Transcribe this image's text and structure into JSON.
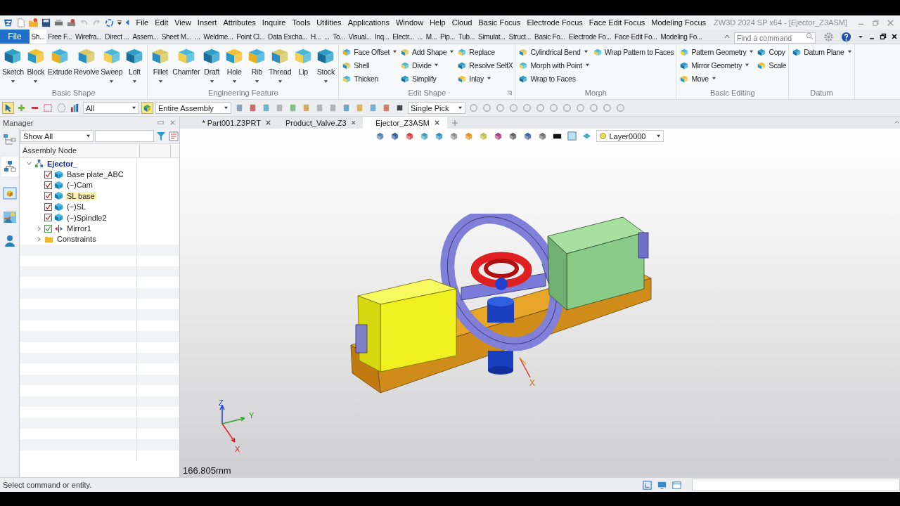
{
  "window": {
    "title": "ZW3D 2024 SP x64 - [Ejector_Z3ASM]"
  },
  "menu": [
    "File",
    "Edit",
    "View",
    "Insert",
    "Attributes",
    "Inquire",
    "Tools",
    "Utilities",
    "Applications",
    "Window",
    "Help",
    "Cloud",
    "Basic Focus",
    "Electrode Focus",
    "Face Edit Focus",
    "Modeling Focus"
  ],
  "file_button": "File",
  "ribbon_tabs": [
    {
      "label": "Sh...",
      "selected": true
    },
    {
      "label": "Free F...",
      "selected": false
    },
    {
      "label": "Wirefra...",
      "selected": false
    },
    {
      "label": "Direct ...",
      "selected": false
    },
    {
      "label": "Assem...",
      "selected": false
    },
    {
      "label": "Sheet M...",
      "selected": false
    },
    {
      "label": "...",
      "selected": false
    },
    {
      "label": "Weldme...",
      "selected": false
    },
    {
      "label": "Point Cl...",
      "selected": false
    },
    {
      "label": "Data Excha...",
      "selected": false
    },
    {
      "label": "H...",
      "selected": false
    },
    {
      "label": "...",
      "selected": false
    },
    {
      "label": "To...",
      "selected": false
    },
    {
      "label": "Visual...",
      "selected": false
    },
    {
      "label": "Inq...",
      "selected": false
    },
    {
      "label": "Electr...",
      "selected": false
    },
    {
      "label": "...",
      "selected": false
    },
    {
      "label": "M...",
      "selected": false
    },
    {
      "label": "Pip...",
      "selected": false
    },
    {
      "label": "Tub...",
      "selected": false
    },
    {
      "label": "Simulat...",
      "selected": false
    },
    {
      "label": "Struct...",
      "selected": false
    },
    {
      "label": "Basic Fo...",
      "selected": false
    },
    {
      "label": "Electrode Fo...",
      "selected": false
    },
    {
      "label": "Face Edit Fo...",
      "selected": false
    },
    {
      "label": "Modeling Fo...",
      "selected": false
    }
  ],
  "command_search": {
    "placeholder": "Find a command"
  },
  "ribbon_groups": [
    {
      "title": "Basic Shape",
      "kind": "large",
      "tools": [
        {
          "label": "Sketch",
          "dropdown": true
        },
        {
          "label": "Block",
          "dropdown": true
        },
        {
          "label": "Extrude",
          "dropdown": false
        },
        {
          "label": "Revolve",
          "dropdown": false
        },
        {
          "label": "Sweep",
          "dropdown": true
        },
        {
          "label": "Loft",
          "dropdown": true
        }
      ]
    },
    {
      "title": "Engineering Feature",
      "kind": "large",
      "tools": [
        {
          "label": "Fillet",
          "dropdown": true
        },
        {
          "label": "Chamfer",
          "dropdown": false
        },
        {
          "label": "Draft",
          "dropdown": true
        },
        {
          "label": "Hole",
          "dropdown": true
        },
        {
          "label": "Rib",
          "dropdown": true
        },
        {
          "label": "Thread",
          "dropdown": true
        },
        {
          "label": "Lip",
          "dropdown": false
        },
        {
          "label": "Stock",
          "dropdown": true
        }
      ]
    },
    {
      "title": "Edit Shape",
      "kind": "small",
      "columns": [
        [
          {
            "label": "Face Offset",
            "dropdown": true
          },
          {
            "label": "Shell",
            "dropdown": false
          },
          {
            "label": "Thicken",
            "dropdown": false
          }
        ],
        [
          {
            "label": "Add Shape",
            "dropdown": true
          },
          {
            "label": "Divide",
            "dropdown": true
          },
          {
            "label": "Simplify",
            "dropdown": false
          }
        ],
        [
          {
            "label": "Replace",
            "dropdown": false
          },
          {
            "label": "Resolve SelfX",
            "dropdown": false
          },
          {
            "label": "Inlay",
            "dropdown": true
          }
        ]
      ]
    },
    {
      "title": "Morph",
      "kind": "small",
      "columns": [
        [
          {
            "label": "Cylindrical Bend",
            "dropdown": true
          },
          {
            "label": "Morph with Point",
            "dropdown": true
          },
          {
            "label": "Wrap to Faces",
            "dropdown": false
          }
        ],
        [
          {
            "label": "Wrap Pattern to Faces",
            "dropdown": false
          }
        ]
      ]
    },
    {
      "title": "Basic Editing",
      "kind": "small",
      "columns": [
        [
          {
            "label": "Pattern Geometry",
            "dropdown": true
          },
          {
            "label": "Mirror Geometry",
            "dropdown": true
          },
          {
            "label": "Move",
            "dropdown": true
          }
        ],
        [
          {
            "label": "Copy",
            "dropdown": false
          },
          {
            "label": "Scale",
            "dropdown": false
          }
        ]
      ]
    },
    {
      "title": "Datum",
      "kind": "small",
      "columns": [
        [
          {
            "label": "Datum Plane",
            "dropdown": true
          }
        ]
      ]
    }
  ],
  "toolbar": {
    "filter": "All",
    "scope": "Entire Assembly",
    "pick_mode": "Single Pick"
  },
  "manager": {
    "title": "Manager",
    "show_filter": "Show All",
    "column": "Assembly Node",
    "tree": [
      {
        "label": "Ejector_",
        "kind": "assembly",
        "expanded": true,
        "selected": false,
        "children": [
          {
            "label": "Base plate_ABC",
            "kind": "part",
            "checked": true,
            "selected": false
          },
          {
            "label": "(−)Cam",
            "kind": "part",
            "checked": true,
            "selected": false
          },
          {
            "label": "SL base",
            "kind": "part",
            "checked": true,
            "selected": true
          },
          {
            "label": "(−)SL",
            "kind": "part",
            "checked": true,
            "selected": false
          },
          {
            "label": "(−)Spindle2",
            "kind": "part",
            "checked": true,
            "selected": false
          },
          {
            "label": "Mirror1",
            "kind": "mirror",
            "checked": true,
            "expanded": false,
            "selected": false
          },
          {
            "label": "Constraints",
            "kind": "folder",
            "expanded": false,
            "selected": false
          }
        ]
      }
    ]
  },
  "document_tabs": [
    {
      "label": "* Part001.Z3PRT",
      "selected": false
    },
    {
      "label": "Product_Valve.Z3",
      "selected": false
    },
    {
      "label": "Ejector_Z3ASM",
      "selected": true
    }
  ],
  "viewport": {
    "layer": "Layer0000",
    "scale": "166.805mm",
    "axis_labels": [
      "Z",
      "Y",
      "X"
    ],
    "model_axis_label": "X"
  },
  "status_bar": {
    "prompt": "Select command or entity."
  }
}
